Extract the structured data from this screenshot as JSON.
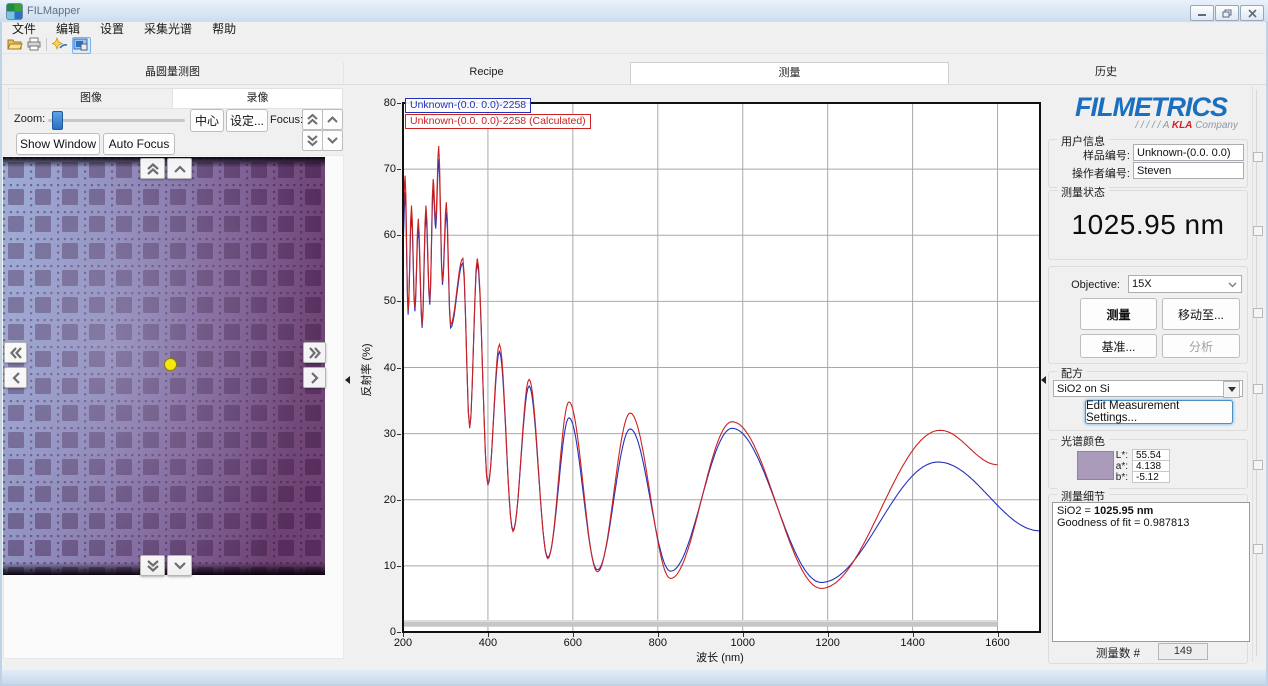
{
  "window": {
    "title": "FILMapper"
  },
  "menu": {
    "items": [
      "文件",
      "编辑",
      "设置",
      "采集光谱",
      "帮助"
    ]
  },
  "toolbar": {
    "icons": [
      "open-file",
      "print",
      "acquire-spectrum",
      "video-window"
    ]
  },
  "main_tabs": {
    "items": [
      {
        "label": "晶圆量测图",
        "active": false
      },
      {
        "label": "Recipe",
        "active": false
      },
      {
        "label": "测量",
        "active": true
      },
      {
        "label": "历史",
        "active": false
      }
    ]
  },
  "camera_panel": {
    "tabs": [
      {
        "label": "图像",
        "active": false
      },
      {
        "label": "录像",
        "active": true
      }
    ],
    "zoom_label": "Zoom:",
    "center_button": "中心",
    "settings_button": "设定...",
    "focus_label": "Focus:",
    "show_window_button": "Show Window",
    "auto_focus_button": "Auto Focus"
  },
  "chart_data": {
    "type": "line",
    "xlabel": "波长 (nm)",
    "ylabel": "反射率 (%)",
    "xlim": [
      200,
      1700
    ],
    "ylim": [
      0,
      80
    ],
    "xticks": [
      200,
      400,
      600,
      800,
      1000,
      1200,
      1400,
      1600
    ],
    "yticks": [
      0,
      10,
      20,
      30,
      40,
      50,
      60,
      70,
      80
    ],
    "grid": true,
    "legend_position": "top-left",
    "series": [
      {
        "name": "Unknown-(0.0. 0.0)-2258",
        "color": "#2233bb",
        "points": [
          [
            200,
            59
          ],
          [
            205,
            66.5
          ],
          [
            212,
            48
          ],
          [
            220,
            63
          ],
          [
            228,
            48.5
          ],
          [
            236,
            61
          ],
          [
            245,
            46
          ],
          [
            254,
            63
          ],
          [
            263,
            49.5
          ],
          [
            271,
            67
          ],
          [
            277,
            61
          ],
          [
            284,
            71.5
          ],
          [
            293,
            52.5
          ],
          [
            302,
            63.5
          ],
          [
            312,
            46
          ],
          [
            341,
            55.8
          ],
          [
            357,
            31
          ],
          [
            375,
            55.8
          ],
          [
            400,
            22.4
          ],
          [
            427,
            42.4
          ],
          [
            459,
            15.4
          ],
          [
            497,
            37.2
          ],
          [
            541,
            11.3
          ],
          [
            591,
            32.4
          ],
          [
            658,
            9.4
          ],
          [
            735,
            30.7
          ],
          [
            830,
            9.2
          ],
          [
            975,
            30.8
          ],
          [
            1185,
            7.5
          ],
          [
            1460,
            25.7
          ],
          [
            1700,
            15.3
          ]
        ]
      },
      {
        "name": "Unknown-(0.0. 0.0)-2258 (Calculated)",
        "color": "#cc2222",
        "points": [
          [
            200,
            62
          ],
          [
            205,
            69
          ],
          [
            212,
            48.5
          ],
          [
            220,
            64.5
          ],
          [
            228,
            49
          ],
          [
            236,
            62.5
          ],
          [
            245,
            46.5
          ],
          [
            254,
            64.5
          ],
          [
            263,
            50
          ],
          [
            271,
            68.5
          ],
          [
            277,
            62
          ],
          [
            284,
            73.5
          ],
          [
            293,
            53
          ],
          [
            302,
            65
          ],
          [
            312,
            46.5
          ],
          [
            341,
            56.5
          ],
          [
            357,
            30.8
          ],
          [
            375,
            56.5
          ],
          [
            400,
            22.2
          ],
          [
            427,
            43.5
          ],
          [
            459,
            15.2
          ],
          [
            497,
            38.2
          ],
          [
            541,
            11.1
          ],
          [
            591,
            34.8
          ],
          [
            658,
            9.1
          ],
          [
            735,
            33.1
          ],
          [
            830,
            8.1
          ],
          [
            975,
            31.8
          ],
          [
            1185,
            6.6
          ],
          [
            1465,
            30.5
          ],
          [
            1600,
            25.3
          ]
        ]
      }
    ],
    "range_bar": {
      "x0": 200,
      "x1": 1600,
      "y_top": 1.8,
      "y_bottom": 0.8,
      "color": "#c6c6c6"
    }
  },
  "right_panel": {
    "logo": {
      "brand": "FILMETRICS",
      "tagline_slashes": "/ / / / /",
      "tagline_a": "A",
      "tagline_brand": "KLA",
      "tagline_rest": "Company"
    },
    "user_info": {
      "title": "用户信息",
      "sample_label": "样品编号:",
      "sample_value": "Unknown-(0.0. 0.0)",
      "operator_label": "操作者编号:",
      "operator_value": "Steven"
    },
    "status": {
      "title": "测量状态",
      "value": "1025.95 nm"
    },
    "controls": {
      "objective_label": "Objective:",
      "objective_value": "15X",
      "measure_button": "测量",
      "move_to_button": "移动至...",
      "baseline_button": "基准...",
      "analyze_button": "分析"
    },
    "recipe": {
      "title": "配方",
      "value": "SiO2 on Si",
      "edit_button": "Edit Measurement Settings..."
    },
    "spectrum_color": {
      "title": "光谱颜色",
      "swatch_color": "#ab9bba",
      "l_label": "L*:",
      "l_value": "55.54",
      "a_label": "a*:",
      "a_value": "4.138",
      "b_label": "b*:",
      "b_value": "-5.12"
    },
    "details": {
      "title": "测量细节",
      "line1_prefix": "SiO2 = ",
      "line1_value": "1025.95 nm",
      "line2": "Goodness of fit = 0.987813",
      "count_label": "测量数 #",
      "count_value": "149"
    }
  }
}
